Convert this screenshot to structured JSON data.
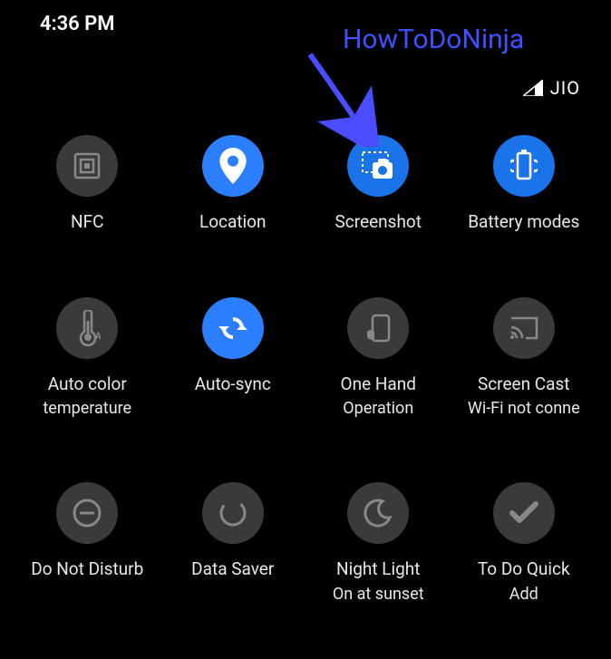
{
  "status": {
    "time": "4:36 PM",
    "carrier": "JIO"
  },
  "watermark": "HowToDoNinja",
  "tiles": {
    "nfc": {
      "label": "NFC",
      "state": "off"
    },
    "location": {
      "label": "Location",
      "state": "on"
    },
    "screenshot": {
      "label": "Screenshot",
      "state": "on"
    },
    "battery_modes": {
      "label": "Battery modes",
      "state": "on"
    },
    "auto_color_temp": {
      "label": "Auto color",
      "sublabel": "temperature",
      "state": "off"
    },
    "auto_sync": {
      "label": "Auto-sync",
      "state": "on"
    },
    "one_hand": {
      "label": "One Hand",
      "sublabel": "Operation",
      "state": "off"
    },
    "screen_cast": {
      "label": "Screen Cast",
      "sublabel": "Wi-Fi not conne",
      "state": "off"
    },
    "dnd": {
      "label": "Do Not Disturb",
      "state": "off"
    },
    "data_saver": {
      "label": "Data Saver",
      "state": "off"
    },
    "night_light": {
      "label": "Night Light",
      "sublabel": "On at sunset",
      "state": "off"
    },
    "todo": {
      "label": "To Do Quick",
      "sublabel": "Add",
      "state": "off"
    }
  }
}
